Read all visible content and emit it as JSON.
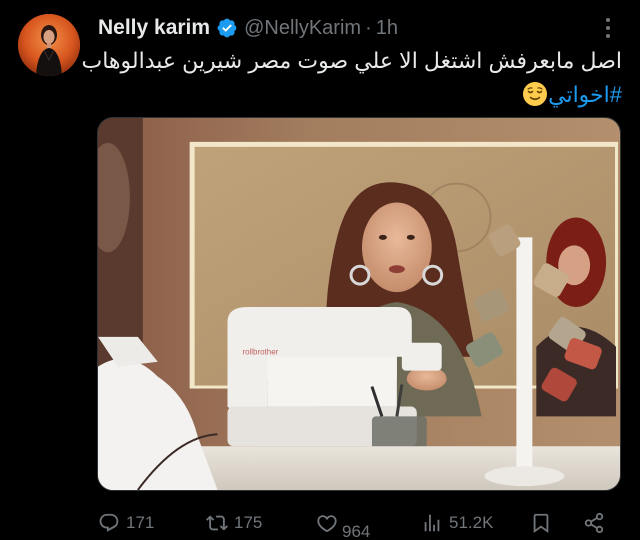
{
  "tweet": {
    "author": {
      "display_name": "Nelly karim",
      "handle": "@NellyKarim",
      "verified": true
    },
    "time_separator": "·",
    "time": "1h",
    "text_line1": "اصل مابعرفش اشتغل الا علي صوت مصر  شيرين عبدالوهاب",
    "hashtag": "#اخواتي",
    "emoji": "relieved-face-emoji",
    "media": {
      "type": "video-still",
      "sewing_machine_label": "rollbrother"
    },
    "stats": {
      "replies": "171",
      "retweets": "175",
      "likes": "964",
      "views": "51.2K"
    }
  },
  "icons": {
    "more": "more-dots-icon",
    "reply": "reply-icon",
    "retweet": "retweet-icon",
    "like": "heart-icon",
    "views": "views-icon",
    "bookmark": "bookmark-icon",
    "share": "share-icon"
  },
  "colors": {
    "background": "#000000",
    "text": "#e7e9ea",
    "muted": "#71767b",
    "accent": "#1d9bf0"
  }
}
